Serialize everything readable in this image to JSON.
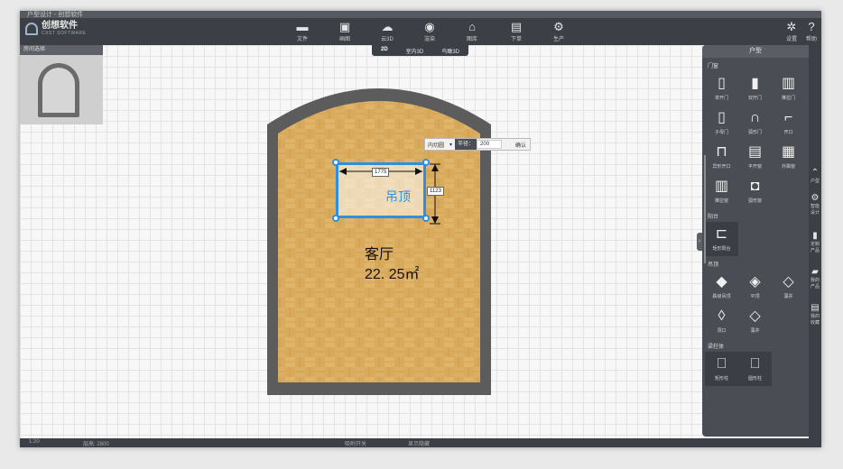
{
  "window": {
    "title": "户型设计 - 创想软件"
  },
  "app": {
    "logo_text": "创想软件",
    "logo_sub": "CXST SOFTWARE"
  },
  "toolbar": {
    "items": [
      {
        "label": "文件",
        "icon": "folder-icon"
      },
      {
        "label": "画图",
        "icon": "draw-icon"
      },
      {
        "label": "云3D",
        "icon": "cloud-icon"
      },
      {
        "label": "渲染",
        "icon": "render-icon"
      },
      {
        "label": "图库",
        "icon": "library-icon"
      },
      {
        "label": "下单",
        "icon": "order-icon"
      },
      {
        "label": "生产",
        "icon": "production-icon"
      }
    ],
    "settings": "设置",
    "help": "帮助"
  },
  "view_tabs": [
    "2D",
    "室内3D",
    "鸟瞰3D"
  ],
  "thumbnail": {
    "title": "房间选择"
  },
  "room": {
    "name": "客厅",
    "area": "22. 25㎡"
  },
  "ceiling": {
    "label": "吊顶",
    "width_dim": "1775",
    "height_dim": "1123"
  },
  "popup": {
    "shape": "内切圆",
    "radius_label": "半径：",
    "radius_value": "200",
    "confirm": "确认"
  },
  "panel": {
    "title": "户型",
    "sections": [
      {
        "title": "门窗",
        "items": [
          "单开门",
          "双开门",
          "推拉门",
          "子母门",
          "弧形门",
          "开口",
          "异形开口",
          "平开窗",
          "外飘窗",
          "推拉窗",
          "弧形窗"
        ]
      },
      {
        "title": "阳台",
        "items": [
          "矩形阳台"
        ]
      },
      {
        "title": "吊顶",
        "items": [
          "跌级吊顶",
          "平顶",
          "藻井",
          "洞口",
          "藻井"
        ]
      },
      {
        "title": "梁柱体",
        "items": [
          "矩形柱",
          "圆形柱"
        ]
      }
    ]
  },
  "right_strip": [
    "户型",
    "智能设计",
    "定制产品",
    "我的产品",
    "我的收藏"
  ],
  "status": {
    "zoom": "1:20",
    "height": "层高: 2800",
    "snap": "吸附开关",
    "hide": "显示隐藏"
  },
  "colors": {
    "accent": "#2e8fe0",
    "wall": "#5c5c5c",
    "floor": "#d8a95a",
    "panel": "#4a4e54"
  }
}
